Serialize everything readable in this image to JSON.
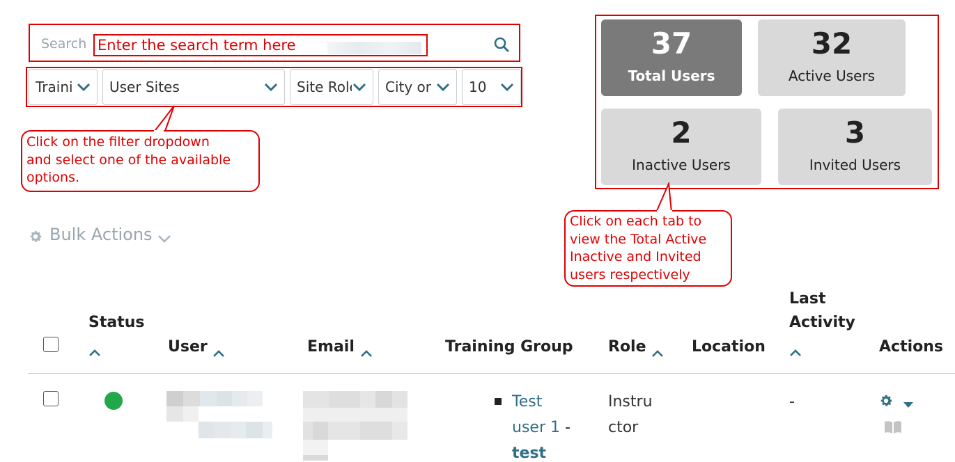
{
  "search": {
    "label": "Search",
    "placeholder": "Enter the search term here"
  },
  "filters": [
    {
      "label": "Traini"
    },
    {
      "label": "User Sites"
    },
    {
      "label": "Site Role"
    },
    {
      "label": "City or"
    },
    {
      "label": "10"
    }
  ],
  "notes": {
    "filter": "Click on the filter dropdown\nand select one of the available\noptions.",
    "tabs": "Click on each tab to\nview the Total Active\nInactive and Invited\nusers respectively"
  },
  "stats": {
    "total": {
      "value": "37",
      "label": "Total Users"
    },
    "active": {
      "value": "32",
      "label": "Active Users"
    },
    "inactive": {
      "value": "2",
      "label": "Inactive Users"
    },
    "invited": {
      "value": "3",
      "label": "Invited Users"
    }
  },
  "bulk_actions": {
    "label": "Bulk Actions"
  },
  "table": {
    "headers": {
      "status": "Status",
      "user": "User",
      "email": "Email",
      "training_group": "Training Group",
      "role": "Role",
      "location": "Location",
      "last_activity_1": "Last",
      "last_activity_2": "Activity",
      "actions": "Actions"
    },
    "rows": [
      {
        "status": "active",
        "training_group_line1": "Test",
        "training_group_line2": "user 1",
        "training_group_sep": " -",
        "training_group_line3": "test",
        "role_line1": "Instru",
        "role_line2": "ctor",
        "last_activity": "-"
      }
    ]
  },
  "colors": {
    "annotation_red": "#e00000",
    "link_teal": "#2f6f87",
    "status_green": "#22a84a",
    "card_active": "#7a7a7a",
    "card_inactive": "#d9d9d9"
  }
}
